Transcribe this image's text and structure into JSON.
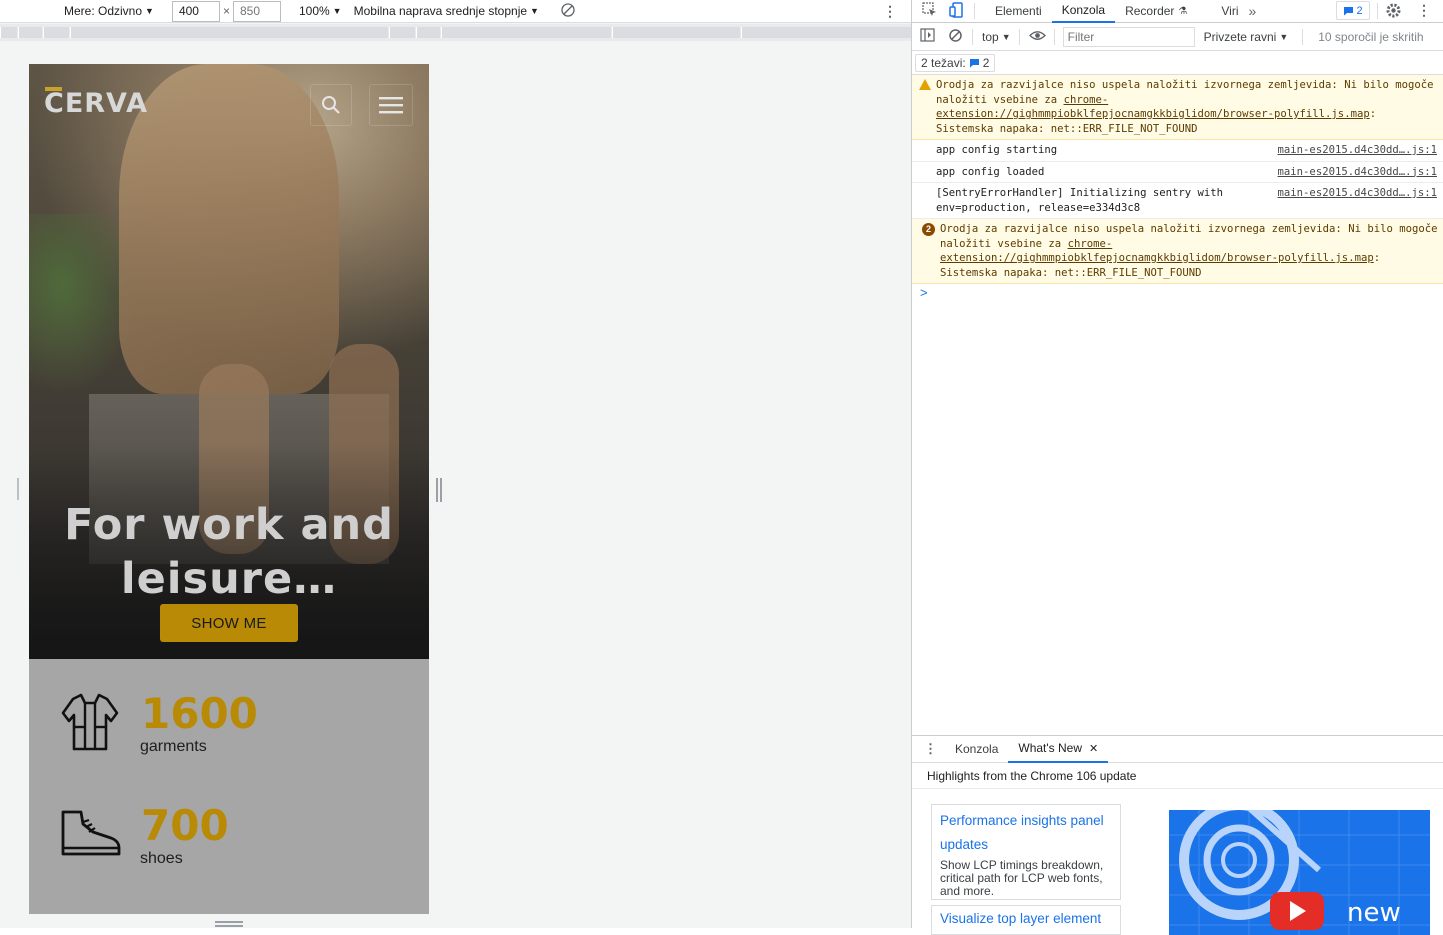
{
  "device_toolbar": {
    "dimensions_label": "Mere: Odzivno",
    "width_value": "400",
    "height_placeholder": "850",
    "times": "×",
    "zoom": "100%",
    "throttle": "Mobilna naprava srednje stopnje"
  },
  "site": {
    "logo": "CERVA",
    "hero_title": "For work and leisure…",
    "cta": "SHOW ME",
    "stats": [
      {
        "number": "1600",
        "label": "garments",
        "icon": "jacket-icon"
      },
      {
        "number": "700",
        "label": "shoes",
        "icon": "boot-icon"
      }
    ],
    "colors": {
      "accent": "#b88a05",
      "stats_bg": "#a6a6a6"
    }
  },
  "devtools": {
    "tabs": [
      "Elementi",
      "Konzola",
      "Recorder",
      "Viri"
    ],
    "active_tab": "Konzola",
    "issues_badge": "2",
    "console_bar": {
      "context": "top",
      "filter_placeholder": "Filter",
      "levels": "Privzete ravni",
      "hidden": "10 sporočil je skritih"
    },
    "issues_label": "2 težavi:",
    "issues_count": "2",
    "messages": [
      {
        "type": "warning",
        "text_before": "Orodja za razvijalce niso uspela naložiti izvornega zemljevida: Ni bilo mogoče naložiti vsebine za ",
        "link": "chrome-extension://gighmmpiobklfepjocnamgkkbiglidom/browser-polyfill.js.map",
        "text_after": ": Sistemska napaka: net::ERR_FILE_NOT_FOUND"
      },
      {
        "type": "log",
        "text": "app config starting",
        "source": "main-es2015.d4c30dd….js:1"
      },
      {
        "type": "log",
        "text": "app config loaded",
        "source": "main-es2015.d4c30dd….js:1"
      },
      {
        "type": "log",
        "text": "[SentryErrorHandler] Initializing sentry with env=production, release=e334d3c8",
        "source": "main-es2015.d4c30dd….js:1"
      },
      {
        "type": "warning",
        "count": "2",
        "text_before": "Orodja za razvijalce niso uspela naložiti izvornega zemljevida: Ni bilo mogoče naložiti vsebine za ",
        "link": "chrome-extension://gighmmpiobklfepjocnamgkkbiglidom/browser-polyfill.js.map",
        "text_after": ": Sistemska napaka: net::ERR_FILE_NOT_FOUND"
      }
    ],
    "prompt": ">",
    "drawer": {
      "tabs": [
        "Konzola",
        "What's New"
      ],
      "active": "What's New",
      "close": "✕",
      "header": "Highlights from the Chrome 106 update",
      "card1_title": "Performance insights panel updates",
      "card1_desc": "Show LCP timings breakdown, critical path for LCP web fonts, and more.",
      "card2_title": "Visualize top layer element",
      "video_text": "new"
    }
  }
}
